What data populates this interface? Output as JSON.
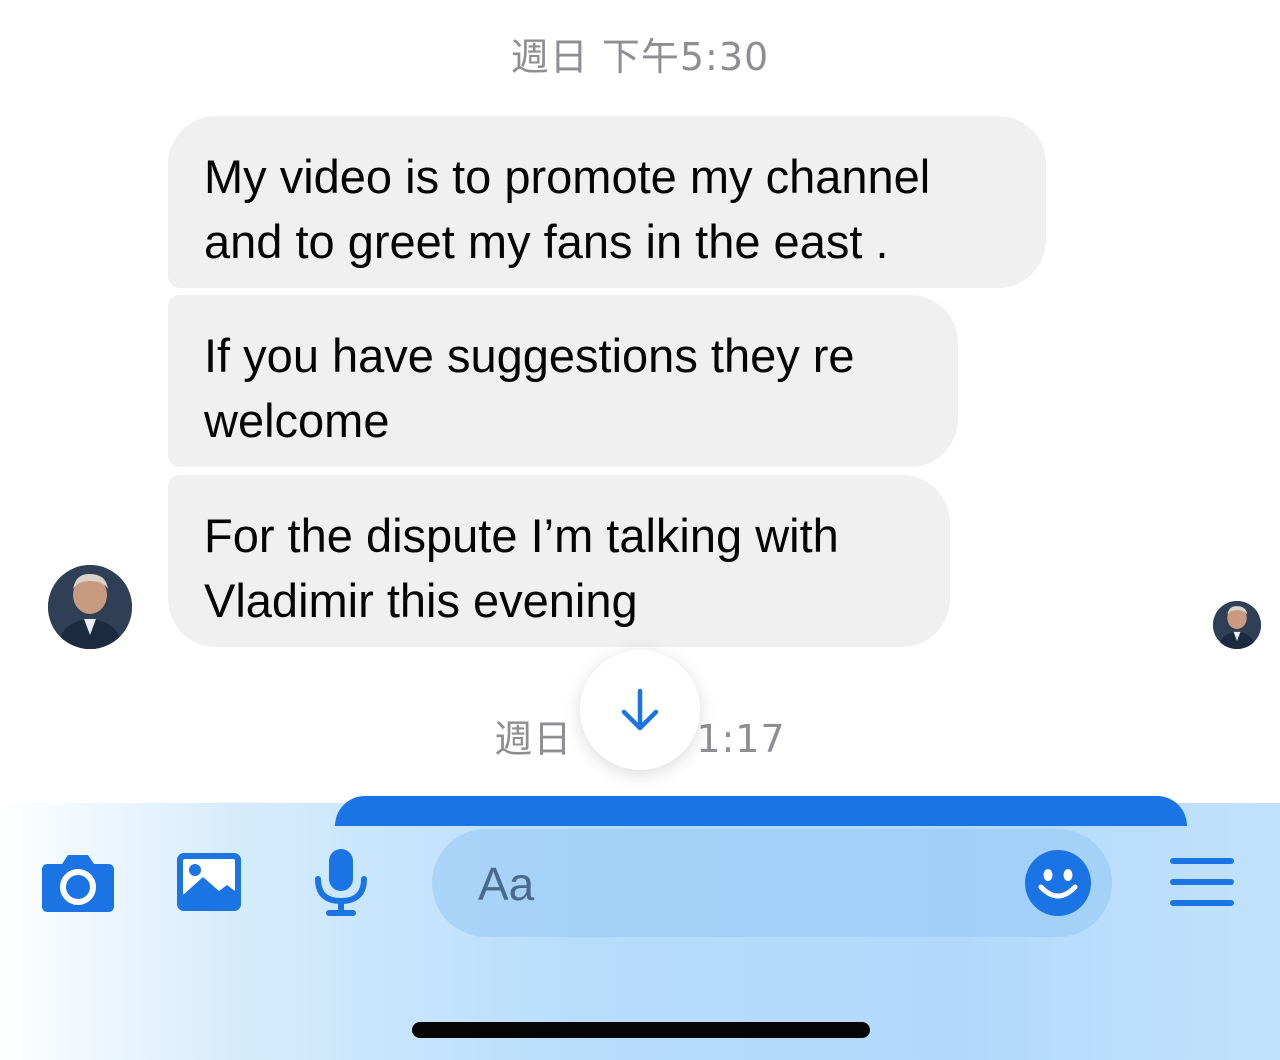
{
  "conversation": {
    "timestamp_top": "週日 下午5:30",
    "messages": [
      {
        "line1": "My video is to promote my channel",
        "line2": "and to greet my fans in the east ."
      },
      {
        "line1": "If you have suggestions they re",
        "line2": "welcome"
      },
      {
        "line1": "For the dispute I’m talking with",
        "line2": "Vladimir this evening"
      }
    ],
    "timestamp_bottom_left": "週日",
    "timestamp_bottom_right": "1:17"
  },
  "composer": {
    "placeholder": "Aa",
    "icons": [
      "camera-icon",
      "gallery-icon",
      "microphone-icon",
      "emoji-icon",
      "menu-icon"
    ]
  },
  "colors": {
    "accent": "#1b74e4",
    "bubble_bg": "#f0f0f0",
    "timestamp": "#8e8e93"
  }
}
